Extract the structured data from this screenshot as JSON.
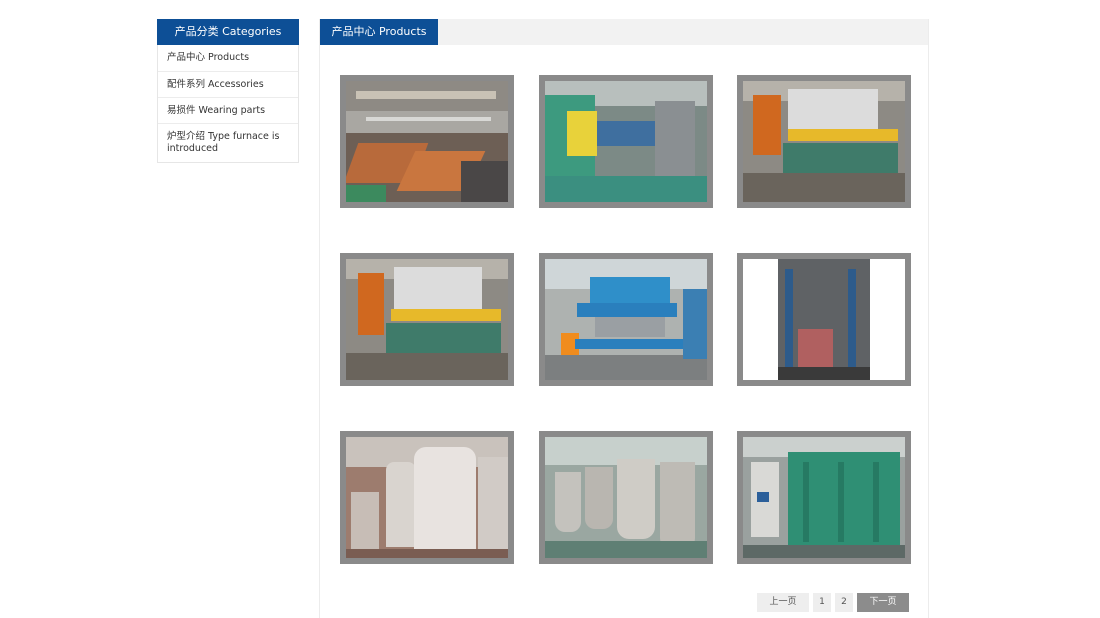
{
  "sidebar": {
    "title": "产品分类 Categories",
    "items": [
      {
        "label": "产品中心 Products"
      },
      {
        "label": "配件系列 Accessories"
      },
      {
        "label": "易损件 Wearing parts"
      },
      {
        "label": "炉型介绍 Type furnace is introduced"
      }
    ]
  },
  "main": {
    "title": "产品中心 Products"
  },
  "pagination": {
    "prev_label": "上一页",
    "page1": "1",
    "page2": "2",
    "next_label": "下一页"
  },
  "colors": {
    "brand_blue": "#0d4f96",
    "header_gray": "#f2f2f2",
    "thumb_frame": "#8a8a8a"
  }
}
